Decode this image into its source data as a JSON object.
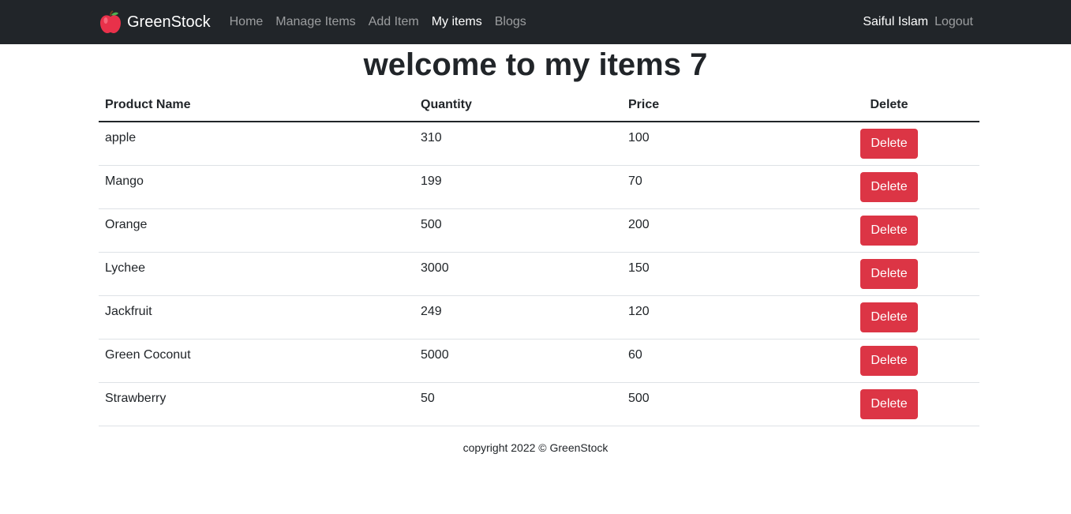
{
  "nav": {
    "brand": "GreenStock",
    "brand_icon": "apple-icon",
    "links": [
      "Home",
      "Manage Items",
      "Add Item",
      "My items",
      "Blogs"
    ],
    "active_link": "My items",
    "user": "Saiful Islam",
    "logout": "Logout"
  },
  "page": {
    "title": "welcome to my items 7"
  },
  "table": {
    "headers": [
      "Product Name",
      "Quantity",
      "Price",
      "Delete"
    ],
    "rows": [
      {
        "name": "apple",
        "quantity": "310",
        "price": "100",
        "action": "Delete"
      },
      {
        "name": "Mango",
        "quantity": "199",
        "price": "70",
        "action": "Delete"
      },
      {
        "name": "Orange",
        "quantity": "500",
        "price": "200",
        "action": "Delete"
      },
      {
        "name": "Lychee",
        "quantity": "3000",
        "price": "150",
        "action": "Delete"
      },
      {
        "name": "Jackfruit",
        "quantity": "249",
        "price": "120",
        "action": "Delete"
      },
      {
        "name": "Green Coconut",
        "quantity": "5000",
        "price": "60",
        "action": "Delete"
      },
      {
        "name": "Strawberry",
        "quantity": "50",
        "price": "500",
        "action": "Delete"
      }
    ]
  },
  "footer": {
    "text": "copyright 2022 © GreenStock"
  },
  "colors": {
    "navbar_bg": "#212529",
    "delete_button": "#dc3545",
    "brand_apple": "#e8314a"
  }
}
